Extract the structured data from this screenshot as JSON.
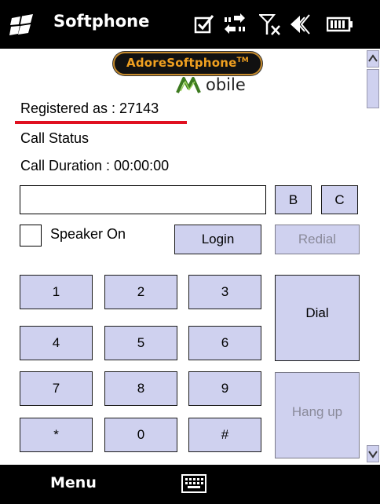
{
  "titlebar": {
    "app_title": "Softphone",
    "icons": [
      "windows-start-icon",
      "checkbox-notification-icon",
      "data-connection-icon",
      "no-signal-icon",
      "volume-icon",
      "battery-icon"
    ]
  },
  "brand": {
    "name": "AdoreSoftphone",
    "trademark": "TM",
    "mobile_suffix": "obile"
  },
  "status": {
    "registered": "Registered as : 27143",
    "call_status": "Call Status",
    "call_duration": "Call Duration :  00:00:00"
  },
  "dialer": {
    "number_value": "",
    "b_label": "B",
    "c_label": "C",
    "speaker_label": "Speaker On",
    "speaker_checked": false,
    "login_label": "Login",
    "redial_label": "Redial",
    "dial_label": "Dial",
    "hangup_label": "Hang up",
    "keys": [
      "1",
      "2",
      "3",
      "4",
      "5",
      "6",
      "7",
      "8",
      "9",
      "*",
      "0",
      "#"
    ]
  },
  "softbar": {
    "menu_label": "Menu"
  },
  "colors": {
    "button_fill": "#cfd1ef",
    "annotation_underline": "#e01020",
    "brand_orange": "#f0a020"
  }
}
